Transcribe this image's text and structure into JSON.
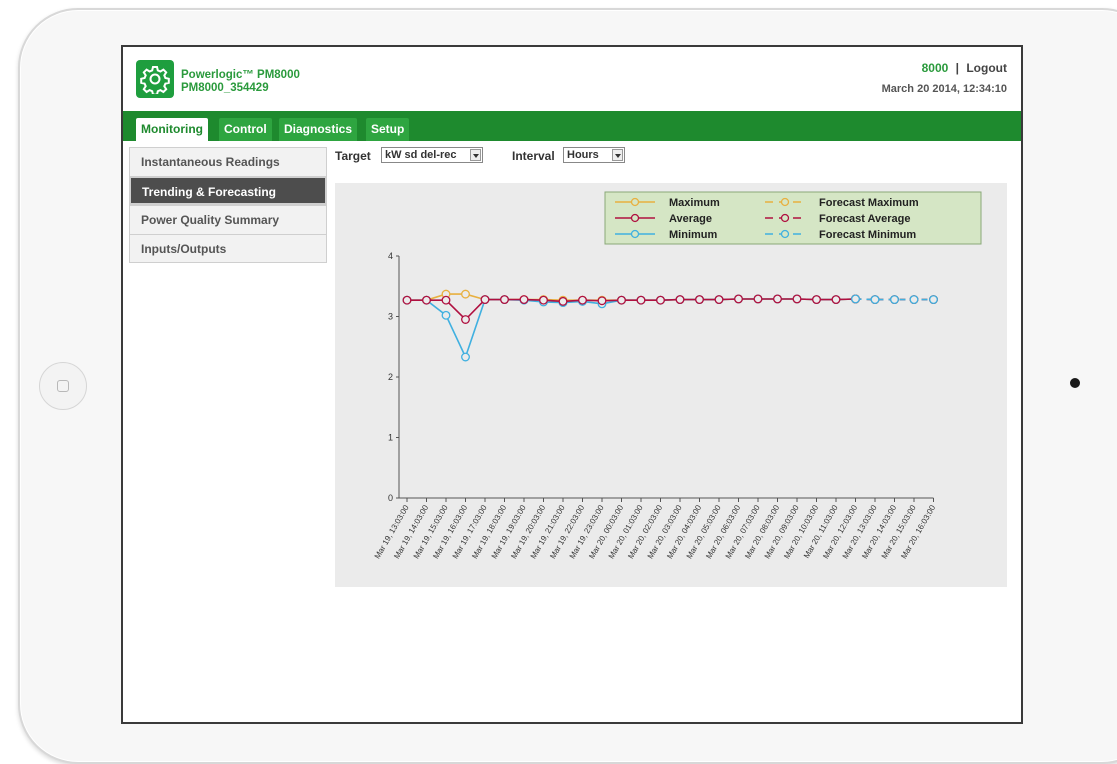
{
  "header": {
    "product_name": "Powerlogic™ PM8000",
    "device_id": "PM8000_354429",
    "user": "8000",
    "separator": "|",
    "logout_label": "Logout",
    "datetime": "March 20 2014, 12:34:10",
    "logo_icon": "gear-icon"
  },
  "nav": {
    "tabs": [
      {
        "label": "Monitoring",
        "active": true
      },
      {
        "label": "Control",
        "active": false
      },
      {
        "label": "Diagnostics",
        "active": false
      },
      {
        "label": "Setup",
        "active": false
      }
    ]
  },
  "sidebar": {
    "items": [
      {
        "label": "Instantaneous Readings",
        "active": false
      },
      {
        "label": "Trending & Forecasting",
        "active": true
      },
      {
        "label": "Power Quality Summary",
        "active": false
      },
      {
        "label": "Inputs/Outputs",
        "active": false
      }
    ]
  },
  "controls": {
    "target_label": "Target",
    "target_value": "kW sd del-rec",
    "interval_label": "Interval",
    "interval_value": "Hours"
  },
  "colors": {
    "brand_green": "#1e8a2e",
    "maximum": "#e8b040",
    "average": "#b01040",
    "minimum": "#40b0e0",
    "legend_bg": "#d5e6c5"
  },
  "chart_data": {
    "type": "line",
    "ylim": [
      0,
      4
    ],
    "yticks": [
      0,
      1,
      2,
      3,
      4
    ],
    "x": [
      "Mar 19, 13:03:00",
      "Mar 19, 14:03:00",
      "Mar 19, 15:03:00",
      "Mar 19, 16:03:00",
      "Mar 19, 17:03:00",
      "Mar 19, 18:03:00",
      "Mar 19, 19:03:00",
      "Mar 19, 20:03:00",
      "Mar 19, 21:03:00",
      "Mar 19, 22:03:00",
      "Mar 19, 23:03:00",
      "Mar 20, 00:03:00",
      "Mar 20, 01:03:00",
      "Mar 20, 02:03:00",
      "Mar 20, 03:03:00",
      "Mar 20, 04:03:00",
      "Mar 20, 05:03:00",
      "Mar 20, 06:03:00",
      "Mar 20, 07:03:00",
      "Mar 20, 08:03:00",
      "Mar 20, 09:03:00",
      "Mar 20, 10:03:00",
      "Mar 20, 11:03:00",
      "Mar 20, 12:03:00",
      "Mar 20, 13:03:00",
      "Mar 20, 14:03:00",
      "Mar 20, 15:03:00",
      "Mar 20, 16:03:00"
    ],
    "legend_position": "top-right",
    "series": [
      {
        "name": "Maximum",
        "color": "#e8b040",
        "dashed": false,
        "values": [
          3.27,
          3.27,
          3.37,
          3.37,
          3.28,
          3.28,
          3.28,
          3.28,
          3.27,
          3.27,
          3.27,
          3.27,
          3.27,
          3.27,
          3.28,
          3.28,
          3.28,
          3.29,
          3.29,
          3.29,
          3.29,
          3.28,
          3.28,
          3.29,
          null,
          null,
          null,
          null
        ]
      },
      {
        "name": "Average",
        "color": "#b01040",
        "dashed": false,
        "values": [
          3.27,
          3.27,
          3.27,
          2.95,
          3.28,
          3.28,
          3.28,
          3.27,
          3.25,
          3.27,
          3.26,
          3.27,
          3.27,
          3.27,
          3.28,
          3.28,
          3.28,
          3.29,
          3.29,
          3.29,
          3.29,
          3.28,
          3.28,
          3.29,
          null,
          null,
          null,
          null
        ]
      },
      {
        "name": "Minimum",
        "color": "#40b0e0",
        "dashed": false,
        "values": [
          3.27,
          3.27,
          3.02,
          2.33,
          3.28,
          3.28,
          3.27,
          3.24,
          3.23,
          3.25,
          3.21,
          3.27,
          3.27,
          3.27,
          3.28,
          3.28,
          3.28,
          3.29,
          3.29,
          3.29,
          3.29,
          3.28,
          3.28,
          3.29,
          null,
          null,
          null,
          null
        ]
      },
      {
        "name": "Forecast Maximum",
        "color": "#e8b040",
        "dashed": true,
        "values": [
          null,
          null,
          null,
          null,
          null,
          null,
          null,
          null,
          null,
          null,
          null,
          null,
          null,
          null,
          null,
          null,
          null,
          null,
          null,
          null,
          null,
          null,
          null,
          3.29,
          3.28,
          3.28,
          3.28,
          3.28
        ]
      },
      {
        "name": "Forecast Average",
        "color": "#b01040",
        "dashed": true,
        "values": [
          null,
          null,
          null,
          null,
          null,
          null,
          null,
          null,
          null,
          null,
          null,
          null,
          null,
          null,
          null,
          null,
          null,
          null,
          null,
          null,
          null,
          null,
          null,
          3.29,
          3.28,
          3.28,
          3.28,
          3.28
        ]
      },
      {
        "name": "Forecast Minimum",
        "color": "#40b0e0",
        "dashed": true,
        "values": [
          null,
          null,
          null,
          null,
          null,
          null,
          null,
          null,
          null,
          null,
          null,
          null,
          null,
          null,
          null,
          null,
          null,
          null,
          null,
          null,
          null,
          null,
          null,
          3.29,
          3.28,
          3.28,
          3.28,
          3.28
        ]
      }
    ]
  }
}
